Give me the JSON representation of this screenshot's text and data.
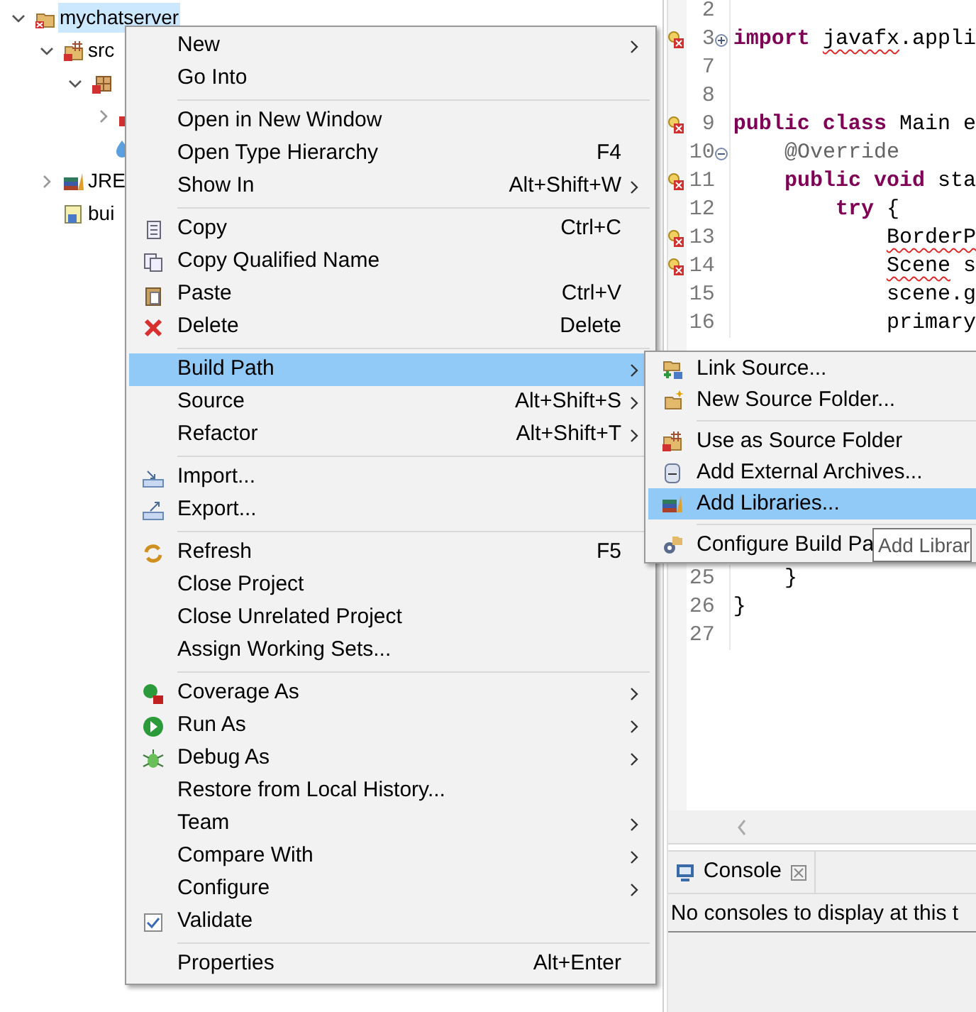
{
  "tree": [
    {
      "label": "mychatserver",
      "selected": true,
      "expanded": true,
      "children": [
        {
          "label": "src",
          "selected": false,
          "expanded": true,
          "children": [
            {
              "expanded": true,
              "children": [
                {
                  "expanded": false
                },
                {
                  "kind": "resource"
                }
              ]
            }
          ]
        },
        {
          "label": "JRE",
          "selected": false,
          "expanded": false
        },
        {
          "label": "bui",
          "selected": false
        }
      ]
    }
  ],
  "editor": {
    "lines_top": [
      {
        "number": "2",
        "error": false
      },
      {
        "number": "3",
        "error": true,
        "folded": true,
        "tokens": [
          {
            "text": "import ",
            "kind": "keyword"
          },
          {
            "text": "javafx",
            "kind": "error"
          },
          {
            "text": ".appli",
            "kind": "plain"
          }
        ]
      },
      {
        "number": "7",
        "error": false
      },
      {
        "number": "8",
        "error": false
      },
      {
        "number": "9",
        "error": true,
        "tokens": [
          {
            "text": "public class",
            "kind": "keyword"
          },
          {
            "text": " Main e",
            "kind": "plain"
          }
        ]
      },
      {
        "number": "10",
        "error": false,
        "folded": false,
        "tokens": [
          {
            "text": "    @Override",
            "kind": "annotation"
          }
        ]
      },
      {
        "number": "11",
        "error": true,
        "tokens": [
          {
            "text": "    public void",
            "kind": "keyword"
          },
          {
            "text": " sta",
            "kind": "plain"
          }
        ]
      },
      {
        "number": "12",
        "error": false,
        "tokens": [
          {
            "text": "        try",
            "kind": "keyword"
          },
          {
            "text": " {",
            "kind": "plain"
          }
        ]
      },
      {
        "number": "13",
        "error": true,
        "tokens": [
          {
            "text": "            BorderP",
            "kind": "error"
          }
        ]
      },
      {
        "number": "14",
        "error": true,
        "tokens": [
          {
            "text": "            Scene",
            "kind": "error"
          },
          {
            "text": " s",
            "kind": "plain"
          }
        ]
      },
      {
        "number": "15",
        "error": false,
        "tokens": [
          {
            "text": "            scene.g",
            "kind": "plain"
          }
        ]
      },
      {
        "number": "16",
        "error": false,
        "tokens": [
          {
            "text": "            primary",
            "kind": "plain"
          }
        ]
      }
    ],
    "lines_bottom": [
      {
        "number": "25",
        "error": false,
        "tokens": [
          {
            "text": "    }",
            "kind": "plain"
          }
        ]
      },
      {
        "number": "26",
        "error": false,
        "tokens": [
          {
            "text": "}",
            "kind": "plain"
          }
        ]
      },
      {
        "number": "27",
        "error": false
      }
    ]
  },
  "console": {
    "tab": "Console",
    "message": "No consoles to display at this t"
  },
  "context_menu": [
    {
      "kind": "item",
      "label": "New",
      "submenu": true,
      "selected": false
    },
    {
      "kind": "item",
      "label": "Go Into",
      "submenu": false,
      "selected": false
    },
    {
      "kind": "separator"
    },
    {
      "kind": "item",
      "label": "Open in New Window",
      "submenu": false,
      "selected": false
    },
    {
      "kind": "item",
      "label": "Open Type Hierarchy",
      "shortcut": "F4",
      "submenu": false,
      "selected": false
    },
    {
      "kind": "item",
      "label": "Show In",
      "shortcut": "Alt+Shift+W",
      "submenu": true,
      "selected": false
    },
    {
      "kind": "separator"
    },
    {
      "kind": "item",
      "label": "Copy",
      "shortcut": "Ctrl+C",
      "submenu": false,
      "selected": false
    },
    {
      "kind": "item",
      "label": "Copy Qualified Name",
      "submenu": false,
      "selected": false
    },
    {
      "kind": "item",
      "label": "Paste",
      "shortcut": "Ctrl+V",
      "submenu": false,
      "selected": false
    },
    {
      "kind": "item",
      "label": "Delete",
      "shortcut": "Delete",
      "submenu": false,
      "selected": false
    },
    {
      "kind": "separator"
    },
    {
      "kind": "item",
      "label": "Build Path",
      "submenu": true,
      "selected": true
    },
    {
      "kind": "item",
      "label": "Source",
      "shortcut": "Alt+Shift+S",
      "submenu": true,
      "selected": false
    },
    {
      "kind": "item",
      "label": "Refactor",
      "shortcut": "Alt+Shift+T",
      "submenu": true,
      "selected": false
    },
    {
      "kind": "separator"
    },
    {
      "kind": "item",
      "label": "Import...",
      "submenu": false,
      "selected": false
    },
    {
      "kind": "item",
      "label": "Export...",
      "submenu": false,
      "selected": false
    },
    {
      "kind": "separator"
    },
    {
      "kind": "item",
      "label": "Refresh",
      "shortcut": "F5",
      "submenu": false,
      "selected": false
    },
    {
      "kind": "item",
      "label": "Close Project",
      "submenu": false,
      "selected": false
    },
    {
      "kind": "item",
      "label": "Close Unrelated Project",
      "submenu": false,
      "selected": false
    },
    {
      "kind": "item",
      "label": "Assign Working Sets...",
      "submenu": false,
      "selected": false
    },
    {
      "kind": "separator"
    },
    {
      "kind": "item",
      "label": "Coverage As",
      "submenu": true,
      "selected": false
    },
    {
      "kind": "item",
      "label": "Run As",
      "submenu": true,
      "selected": false
    },
    {
      "kind": "item",
      "label": "Debug As",
      "submenu": true,
      "selected": false
    },
    {
      "kind": "item",
      "label": "Restore from Local History...",
      "submenu": false,
      "selected": false
    },
    {
      "kind": "item",
      "label": "Team",
      "submenu": true,
      "selected": false
    },
    {
      "kind": "item",
      "label": "Compare With",
      "submenu": true,
      "selected": false
    },
    {
      "kind": "item",
      "label": "Configure",
      "submenu": true,
      "selected": false
    },
    {
      "kind": "item",
      "label": "Validate",
      "submenu": false,
      "selected": false
    },
    {
      "kind": "separator"
    },
    {
      "kind": "item",
      "label": "Properties",
      "shortcut": "Alt+Enter",
      "submenu": false,
      "selected": false
    }
  ],
  "submenu": [
    {
      "kind": "item",
      "label": "Link Source...",
      "selected": false
    },
    {
      "kind": "item",
      "label": "New Source Folder...",
      "selected": false
    },
    {
      "kind": "separator"
    },
    {
      "kind": "item",
      "label": "Use as Source Folder",
      "selected": false
    },
    {
      "kind": "item",
      "label": "Add External Archives...",
      "selected": false
    },
    {
      "kind": "item",
      "label": "Add Libraries...",
      "selected": true
    },
    {
      "kind": "separator"
    },
    {
      "kind": "item",
      "label": "Configure Build Pa",
      "selected": false
    }
  ],
  "tooltip": "Add Librar"
}
